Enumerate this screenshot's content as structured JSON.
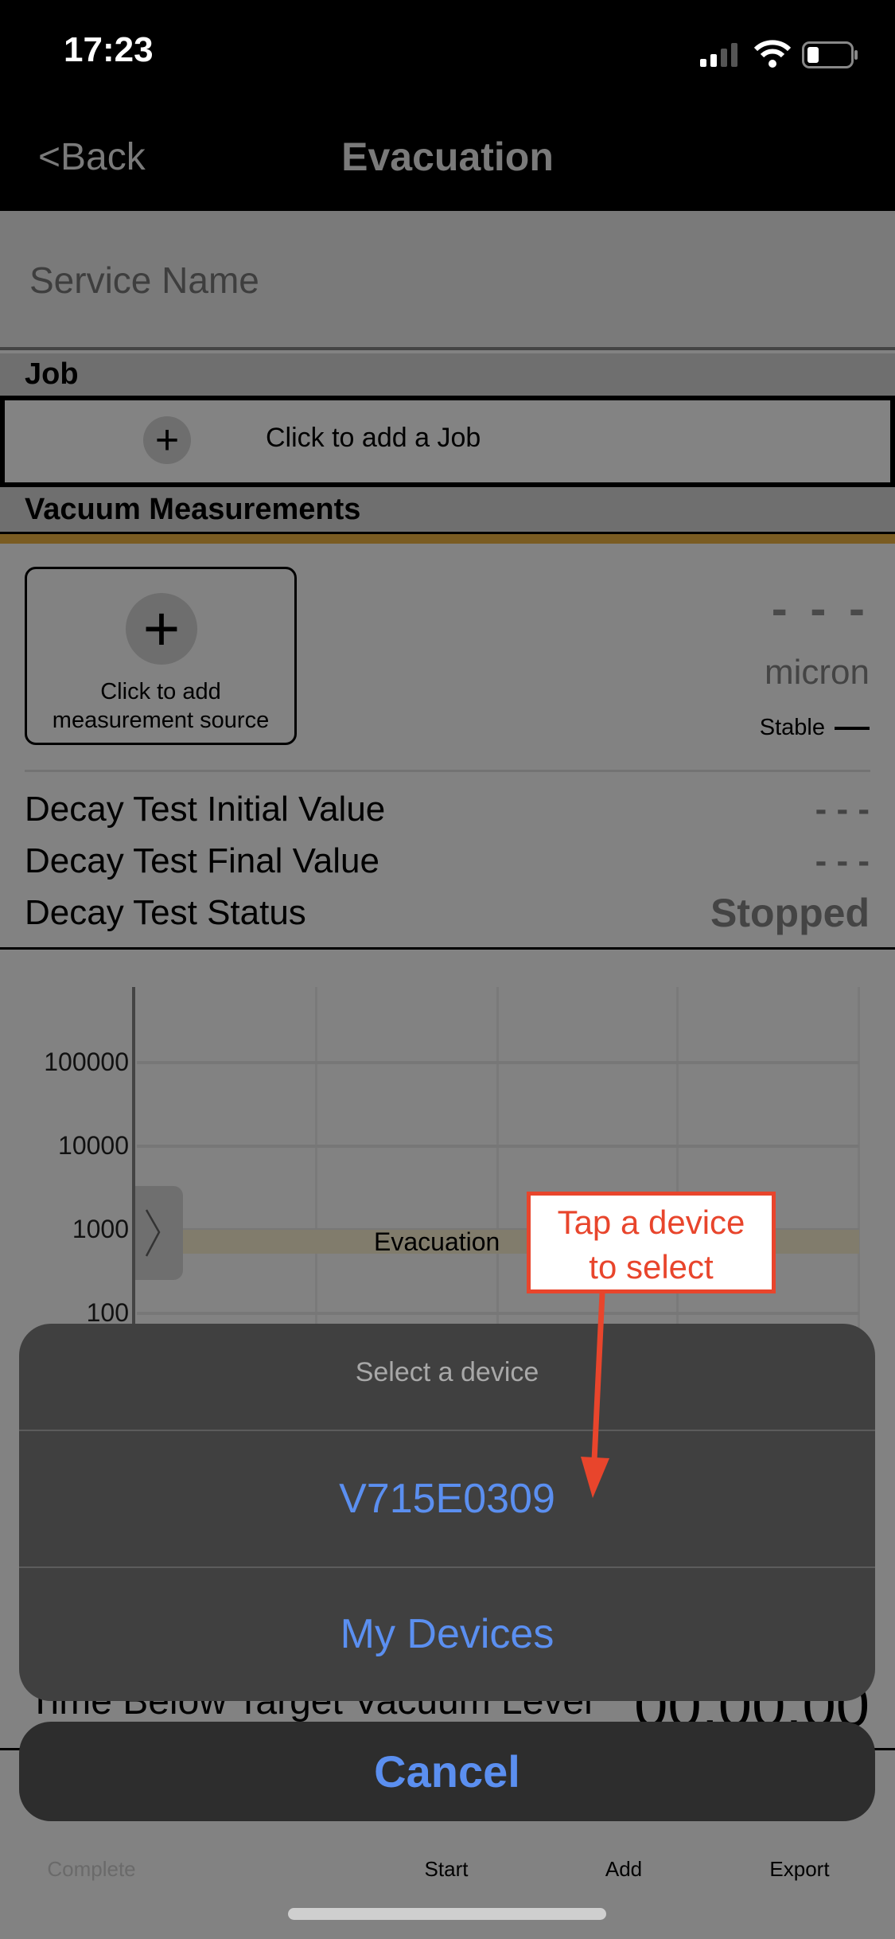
{
  "status_bar": {
    "time": "17:23",
    "icons": [
      "signal-icon",
      "wifi-icon",
      "battery-icon"
    ]
  },
  "nav": {
    "back_label": "<Back",
    "title": "Evacuation"
  },
  "service": {
    "placeholder": "Service Name"
  },
  "job": {
    "header": "Job",
    "add_label": "Click to add a Job"
  },
  "vacuum": {
    "header": "Vacuum Measurements",
    "add_source_label_1": "Click to add",
    "add_source_label_2": "measurement source",
    "reading": "- - -",
    "unit": "micron",
    "stability": "Stable"
  },
  "decay": [
    {
      "label": "Decay Test Initial Value",
      "value": "- - -"
    },
    {
      "label": "Decay Test Final Value",
      "value": "- - -"
    },
    {
      "label": "Decay Test Status",
      "value": "Stopped"
    }
  ],
  "chart": {
    "y_scale": "log",
    "y_ticks": [
      "100000",
      "10000",
      "1000",
      "100"
    ],
    "target_band_label": "Evacuation",
    "target_value": 1000
  },
  "annotation": {
    "line1": "Tap a device",
    "line2": "to select",
    "color": "#e8452c"
  },
  "behind_sheet": {
    "time_below_label": "Time Below Target Vacuum Level",
    "time_below_value": "00:00:00"
  },
  "action_sheet": {
    "title": "Select a device",
    "options": [
      "V715E0309",
      "My Devices"
    ],
    "cancel": "Cancel",
    "accent": "#5b8ff0"
  },
  "tabs": [
    "Complete",
    "Start",
    "Add",
    "Export"
  ]
}
